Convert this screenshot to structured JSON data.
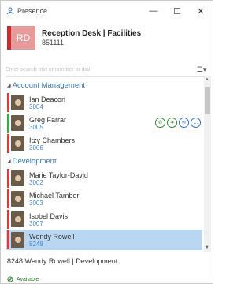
{
  "window": {
    "title": "Presence",
    "controls": {
      "minimize": "—",
      "maximize": "☐",
      "close": "✕"
    }
  },
  "identity": {
    "initials": "RD",
    "name": "Reception Desk | Facilities",
    "ext": "851111",
    "badge_color": "#e69a9a",
    "status_color": "#cc2a2a"
  },
  "search": {
    "placeholder": "Enter search text or number to dial",
    "view_icon": "list-view-icon"
  },
  "groups": [
    {
      "label": "Account Management",
      "contacts": [
        {
          "name": "Ian Deacon",
          "ext": "3004",
          "status_color": "#d83b3b"
        },
        {
          "name": "Greg Farrar",
          "ext": "3005",
          "status_color": "#3aa84a",
          "actions": true
        },
        {
          "name": "Itzy Chambers",
          "ext": "3006",
          "status_color": "#d83b3b"
        }
      ]
    },
    {
      "label": "Development",
      "contacts": [
        {
          "name": "Marie Taylor-David",
          "ext": "3002",
          "status_color": "#d83b3b"
        },
        {
          "name": "Michael Tambor",
          "ext": "3003",
          "status_color": "#d83b3b"
        },
        {
          "name": "Isobel Davis",
          "ext": "3007",
          "status_color": "#d83b3b"
        },
        {
          "name": "Wendy Rowell",
          "ext": "8248",
          "status_color": "#d83b3b",
          "selected": true
        }
      ]
    }
  ],
  "footer": {
    "selection": "8248  Wendy Rowell | Development",
    "presence": "Available",
    "presence_color": "#2a7a2a"
  }
}
